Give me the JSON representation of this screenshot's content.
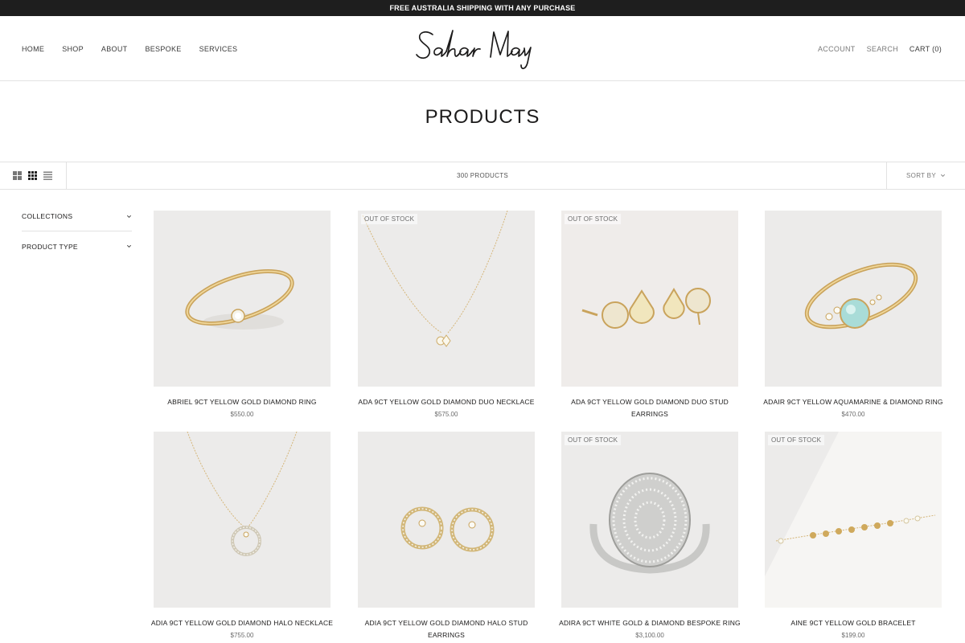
{
  "announcement": "FREE AUSTRALIA SHIPPING WITH ANY PURCHASE",
  "brand": "Sahar May",
  "nav_left": [
    "HOME",
    "SHOP",
    "ABOUT",
    "BESPOKE",
    "SERVICES"
  ],
  "nav_right": {
    "account": "ACCOUNT",
    "search": "SEARCH",
    "cart": "CART (0)"
  },
  "page_title": "PRODUCTS",
  "toolbar": {
    "count": "300 PRODUCTS",
    "sort_label": "SORT BY",
    "view_icons": [
      "grid-large-icon",
      "grid-small-icon",
      "list-view-icon"
    ]
  },
  "filters": [
    {
      "label": "COLLECTIONS"
    },
    {
      "label": "PRODUCT TYPE"
    }
  ],
  "products": [
    {
      "name": "ABRIEL 9CT YELLOW GOLD DIAMOND RING",
      "price": "$550.00",
      "badge": "",
      "image": "ring-solitaire"
    },
    {
      "name": "ADA 9CT YELLOW GOLD DIAMOND DUO NECKLACE",
      "price": "$575.00",
      "badge": "OUT OF STOCK",
      "image": "necklace-duo"
    },
    {
      "name": "ADA 9CT YELLOW GOLD DIAMOND DUO STUD EARRINGS",
      "price": "",
      "badge": "OUT OF STOCK",
      "image": "earrings-duo"
    },
    {
      "name": "ADAIR 9CT YELLOW AQUAMARINE & DIAMOND RING",
      "price": "$470.00",
      "badge": "",
      "image": "ring-aquamarine"
    },
    {
      "name": "ADIA 9CT YELLOW GOLD DIAMOND HALO NECKLACE",
      "price": "$755.00",
      "badge": "",
      "image": "necklace-halo"
    },
    {
      "name": "ADIA 9CT YELLOW GOLD DIAMOND HALO STUD EARRINGS",
      "price": "",
      "badge": "",
      "image": "earrings-halo"
    },
    {
      "name": "ADIRA 9CT WHITE GOLD & DIAMOND BESPOKE RING",
      "price": "$3,100.00",
      "badge": "OUT OF STOCK",
      "image": "ring-pave"
    },
    {
      "name": "AINE 9CT YELLOW GOLD BRACELET",
      "price": "$199.00",
      "badge": "OUT OF STOCK",
      "image": "bracelet"
    }
  ],
  "colors": {
    "announcement_bg": "#1e1e1e",
    "text": "#1c1b1b",
    "muted": "#7a7a7a",
    "border": "#e2e2e2",
    "gold": "#d9b46a",
    "aquamarine": "#9fd6d4"
  }
}
